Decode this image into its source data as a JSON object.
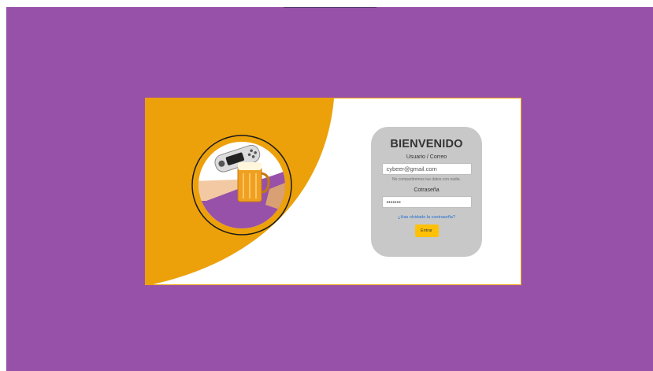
{
  "login": {
    "title": "BIENVENIDO",
    "user_label": "Usuario / Correo",
    "user_value": "cybeer@gmail.com",
    "user_hint": "No compartiremos tus datos con nadie.",
    "password_label": "Cotraseña",
    "password_value": "•••••••",
    "forgot_link": "¿Has olvidado la contraseña?",
    "submit_label": "Entrar"
  },
  "colors": {
    "background": "#9751a8",
    "accent": "#eca10b",
    "card": "#ffffff",
    "login_panel": "#c8c8c8",
    "button": "#ffc107",
    "link": "#1f6fd1"
  },
  "icons": [
    "gamepad-and-beer-icon"
  ]
}
